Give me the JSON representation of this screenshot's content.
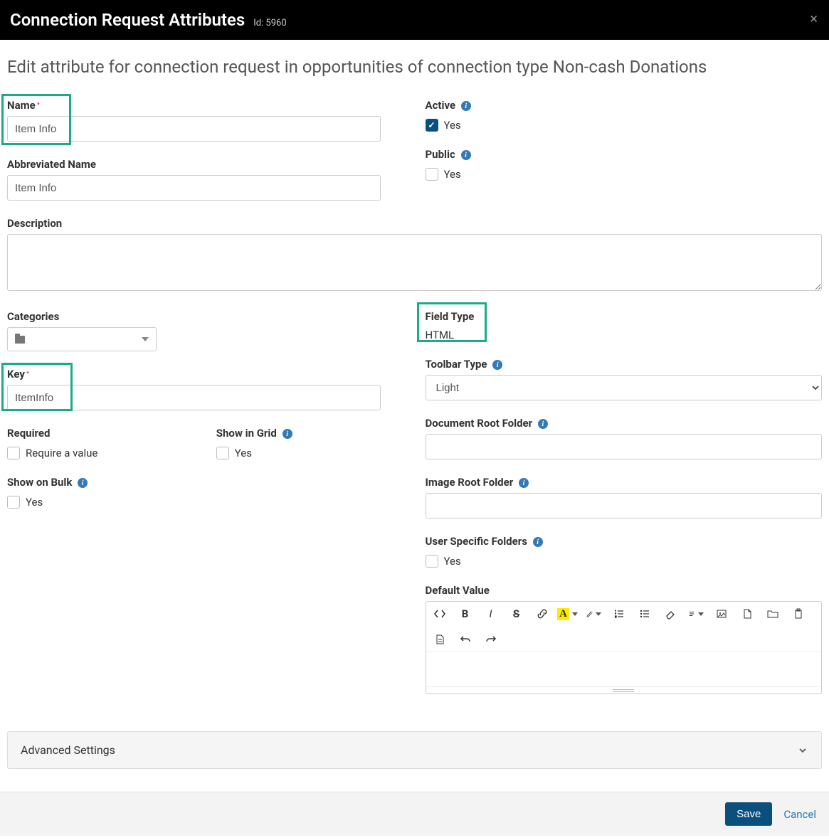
{
  "header": {
    "title": "Connection Request Attributes",
    "id_label": "Id: 5960"
  },
  "subtitle": "Edit attribute for connection request in opportunities of connection type Non-cash Donations",
  "left": {
    "name_label": "Name",
    "name_value": "Item Info",
    "abbrev_label": "Abbreviated Name",
    "abbrev_value": "Item Info",
    "desc_label": "Description",
    "desc_value": "",
    "categories_label": "Categories",
    "key_label": "Key",
    "key_value": "ItemInfo",
    "required_label": "Required",
    "required_check": "Require a value",
    "showgrid_label": "Show in Grid",
    "showgrid_check": "Yes",
    "showbulk_label": "Show on Bulk",
    "showbulk_check": "Yes"
  },
  "right": {
    "active_label": "Active",
    "active_check": "Yes",
    "public_label": "Public",
    "public_check": "Yes",
    "fieldtype_label": "Field Type",
    "fieldtype_value": "HTML",
    "toolbartype_label": "Toolbar Type",
    "toolbartype_value": "Light",
    "docroot_label": "Document Root Folder",
    "imgroot_label": "Image Root Folder",
    "userfolders_label": "User Specific Folders",
    "userfolders_check": "Yes",
    "defaultvalue_label": "Default Value"
  },
  "advanced_label": "Advanced Settings",
  "footer": {
    "save": "Save",
    "cancel": "Cancel"
  }
}
